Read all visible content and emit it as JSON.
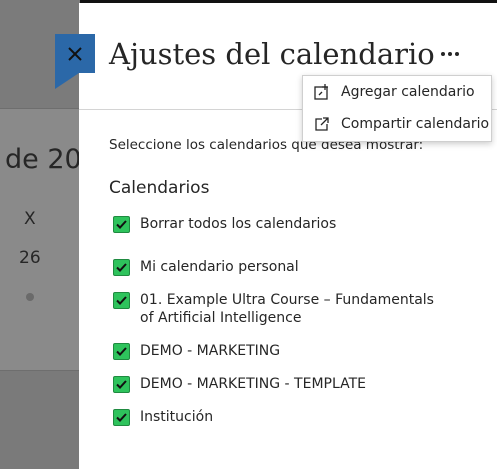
{
  "background": {
    "year_fragment": "de 20",
    "weekday_fragment": "X",
    "day_number": "26"
  },
  "panel": {
    "title": "Ajustes del calendario",
    "more_icon": "more-horizontal-icon",
    "close_icon": "close-icon",
    "instructions": "Seleccione los calendarios que desea mostrar:",
    "section_title": "Calendarios",
    "calendars": [
      {
        "label": "Borrar todos los calendarios",
        "checked": true
      },
      {
        "label": "Mi calendario personal",
        "checked": true
      },
      {
        "label": "01. Example Ultra Course – Fundamentals of Artificial Intelligence",
        "checked": true
      },
      {
        "label": "DEMO - MARKETING",
        "checked": true
      },
      {
        "label": "DEMO - MARKETING - TEMPLATE",
        "checked": true
      },
      {
        "label": "Institución",
        "checked": true
      }
    ]
  },
  "menu": {
    "items": [
      {
        "label": "Agregar calendario",
        "icon": "add-calendar-icon"
      },
      {
        "label": "Compartir calendario",
        "icon": "share-external-icon"
      }
    ]
  },
  "colors": {
    "accent": "#2b68a8",
    "checkbox": "#2ec35c"
  }
}
